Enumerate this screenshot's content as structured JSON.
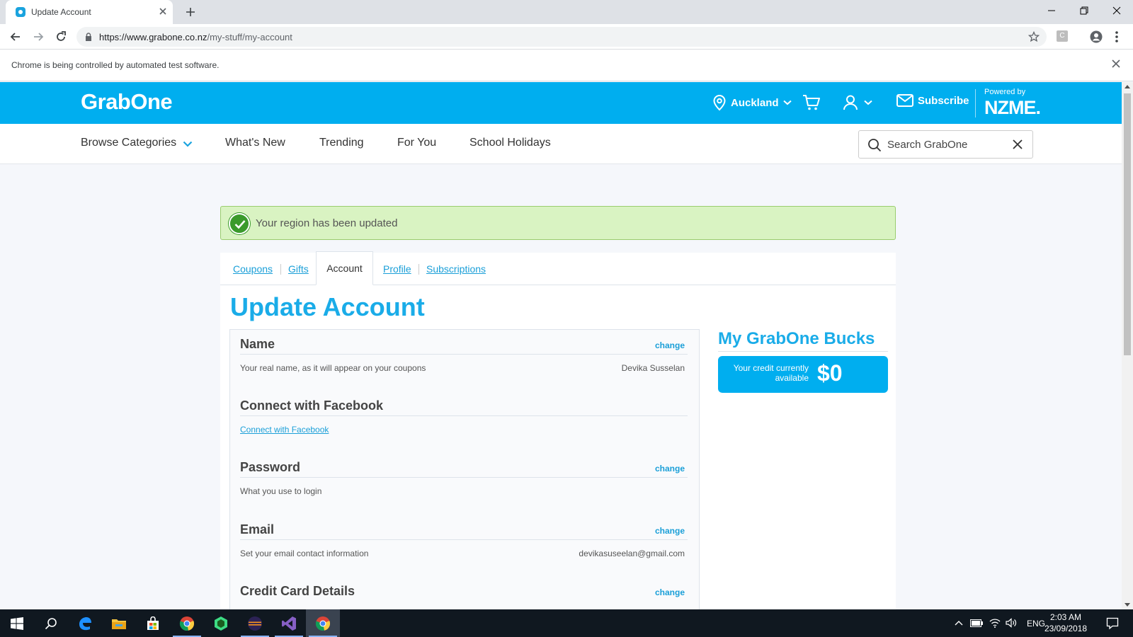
{
  "browser": {
    "tab_title": "Update Account",
    "url_domain": "https://www.grabone.co.nz",
    "url_path": "/my-stuff/my-account",
    "infobar_text": "Chrome is being controlled by automated test software.",
    "extension_letter": "C"
  },
  "site": {
    "logo": "GrabOne",
    "region": "Auckland",
    "subscribe": "Subscribe",
    "powered_by": "Powered by",
    "partner": "NZME.",
    "brand_color": "#00aeef"
  },
  "nav": {
    "items": [
      "Browse Categories",
      "What's New",
      "Trending",
      "For You",
      "School Holidays"
    ],
    "search_placeholder": "Search GrabOne"
  },
  "alert": {
    "message": "Your region has been updated",
    "status_color": "#3a9a2c"
  },
  "account_tabs": {
    "items": [
      "Coupons",
      "Gifts",
      "Account",
      "Profile",
      "Subscriptions"
    ],
    "active": "Account"
  },
  "page": {
    "title": "Update Account"
  },
  "sections": [
    {
      "title": "Name",
      "change": "change",
      "desc": "Your real name, as it will appear on your coupons",
      "value": "Devika Susselan"
    },
    {
      "title": "Connect with Facebook",
      "link": "Connect with Facebook"
    },
    {
      "title": "Password",
      "change": "change",
      "desc": "What you use to login"
    },
    {
      "title": "Email",
      "change": "change",
      "desc": "Set your email contact information",
      "value": "devikasuseelan@gmail.com"
    },
    {
      "title": "Credit Card Details",
      "change": "change"
    }
  ],
  "bucks": {
    "title": "My GrabOne Bucks",
    "label": "Your credit currently available",
    "amount": "$0"
  },
  "taskbar": {
    "language": "ENG",
    "time": "2:03 AM",
    "date": "23/09/2018",
    "apps": [
      "start-icon",
      "search-icon",
      "edge-icon",
      "file-explorer-icon",
      "store-icon",
      "chrome-icon",
      "android-studio-icon",
      "eclipse-icon",
      "visual-studio-icon",
      "chrome-icon"
    ]
  }
}
